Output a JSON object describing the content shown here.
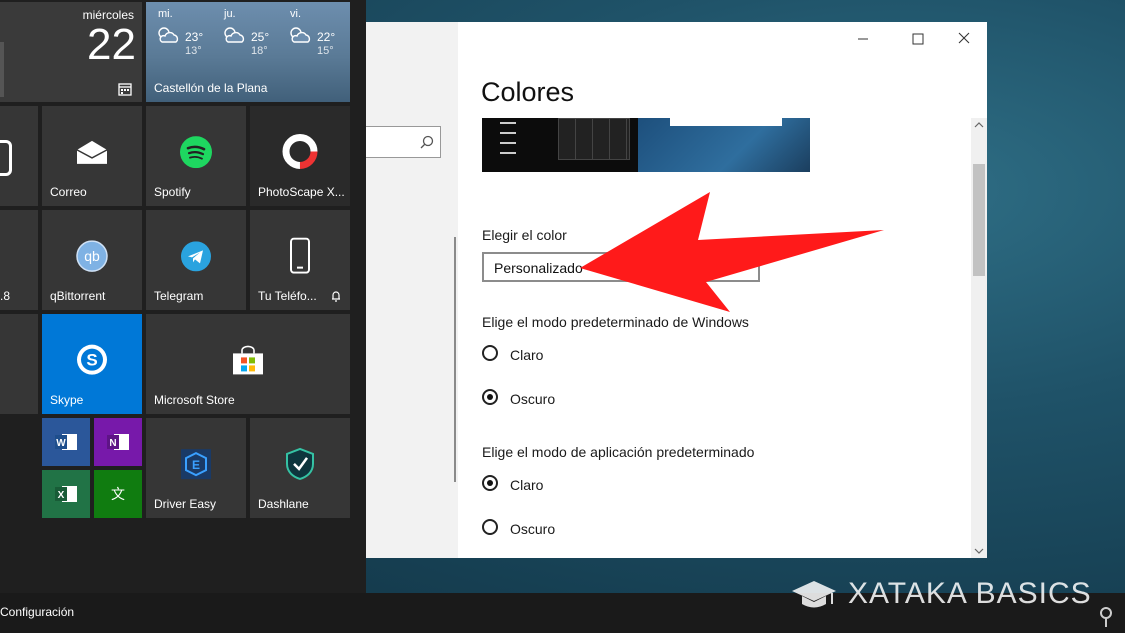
{
  "start_menu": {
    "calendar": {
      "day_name": "miércoles",
      "day_number": "22"
    },
    "weather": {
      "days": [
        {
          "name": "mi.",
          "high": "23°",
          "low": "13°"
        },
        {
          "name": "ju.",
          "high": "25°",
          "low": "18°"
        },
        {
          "name": "vi.",
          "high": "22°",
          "low": "15°"
        }
      ],
      "location": "Castellón de la Plana"
    },
    "tiles": {
      "correo": "Correo",
      "spotify": "Spotify",
      "photoscape": "PhotoScape X...",
      "partial_left": ".8",
      "qbittorrent": "qBittorrent",
      "telegram": "Telegram",
      "phone": "Tu Teléfo...",
      "skype": "Skype",
      "store": "Microsoft Store",
      "drivereasy": "Driver Easy",
      "dashlane": "Dashlane"
    },
    "settings_label": "Configuración"
  },
  "window": {
    "title": "Colores",
    "choose_color": {
      "label": "Elegir el color",
      "selected": "Personalizado"
    },
    "windows_mode": {
      "label": "Elige el modo predeterminado de Windows",
      "options": [
        "Claro",
        "Oscuro"
      ],
      "selected": "Oscuro"
    },
    "app_mode": {
      "label": "Elige el modo de aplicación predeterminado",
      "options": [
        "Claro",
        "Oscuro"
      ],
      "selected": "Claro"
    }
  },
  "watermark": "XATAKA BASICS",
  "colors": {
    "accent_skype": "#0078d7",
    "arrow": "#ff1a1a",
    "tile": "#363636"
  }
}
